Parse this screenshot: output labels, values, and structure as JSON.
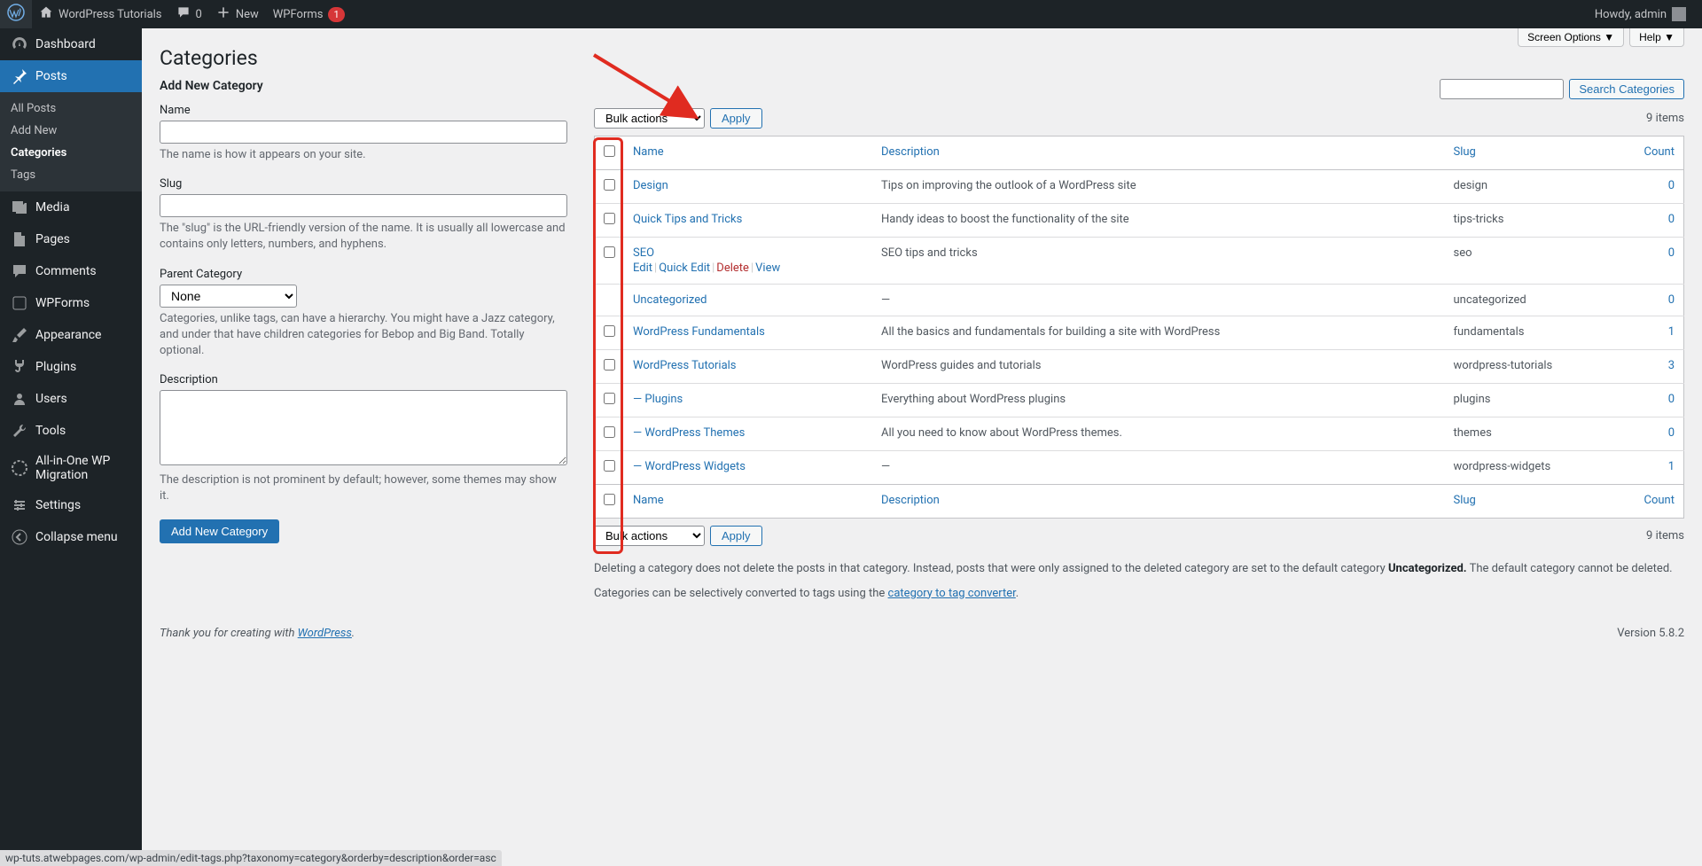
{
  "adminbar": {
    "site_name": "WordPress Tutorials",
    "comments": "0",
    "new": "New",
    "wpforms": "WPForms",
    "wpforms_badge": "1",
    "howdy": "Howdy, admin"
  },
  "sidebar": {
    "dashboard": "Dashboard",
    "posts": "Posts",
    "posts_sub": {
      "all": "All Posts",
      "add": "Add New",
      "categories": "Categories",
      "tags": "Tags"
    },
    "media": "Media",
    "pages": "Pages",
    "comments": "Comments",
    "wpforms": "WPForms",
    "appearance": "Appearance",
    "plugins": "Plugins",
    "users": "Users",
    "tools": "Tools",
    "aiowp": "All-in-One WP Migration",
    "settings": "Settings",
    "collapse": "Collapse menu"
  },
  "topright": {
    "screen_options": "Screen Options",
    "help": "Help"
  },
  "page_title": "Categories",
  "form": {
    "heading": "Add New Category",
    "name_label": "Name",
    "name_desc": "The name is how it appears on your site.",
    "slug_label": "Slug",
    "slug_desc": "The \"slug\" is the URL-friendly version of the name. It is usually all lowercase and contains only letters, numbers, and hyphens.",
    "parent_label": "Parent Category",
    "parent_selected": "None",
    "parent_desc": "Categories, unlike tags, can have a hierarchy. You might have a Jazz category, and under that have children categories for Bebop and Big Band. Totally optional.",
    "desc_label": "Description",
    "desc_desc": "The description is not prominent by default; however, some themes may show it.",
    "submit": "Add New Category"
  },
  "search": {
    "button": "Search Categories"
  },
  "bulk": {
    "label": "Bulk actions",
    "apply": "Apply",
    "items": "9 items"
  },
  "columns": {
    "name": "Name",
    "description": "Description",
    "slug": "Slug",
    "count": "Count"
  },
  "row_actions": {
    "edit": "Edit",
    "quick_edit": "Quick Edit",
    "delete": "Delete",
    "view": "View"
  },
  "rows": [
    {
      "name": "Design",
      "desc": "Tips on improving the outlook of a WordPress site",
      "slug": "design",
      "count": "0",
      "cb": true
    },
    {
      "name": "Quick Tips and Tricks",
      "desc": "Handy ideas to boost the functionality of the site",
      "slug": "tips-tricks",
      "count": "0",
      "cb": true
    },
    {
      "name": "SEO",
      "desc": "SEO tips and tricks",
      "slug": "seo",
      "count": "0",
      "cb": true,
      "actions": true
    },
    {
      "name": "Uncategorized",
      "desc": "—",
      "slug": "uncategorized",
      "count": "0",
      "cb": false
    },
    {
      "name": "WordPress Fundamentals",
      "desc": "All the basics and fundamentals for building a site with WordPress",
      "slug": "fundamentals",
      "count": "1",
      "cb": true
    },
    {
      "name": "WordPress Tutorials",
      "desc": "WordPress guides and tutorials",
      "slug": "wordpress-tutorials",
      "count": "3",
      "cb": true
    },
    {
      "name": "— Plugins",
      "desc": "Everything about WordPress plugins",
      "slug": "plugins",
      "count": "0",
      "cb": true
    },
    {
      "name": "— WordPress Themes",
      "desc": "All you need to know about WordPress themes.",
      "slug": "themes",
      "count": "0",
      "cb": true
    },
    {
      "name": "— WordPress Widgets",
      "desc": "—",
      "slug": "wordpress-widgets",
      "count": "1",
      "cb": true
    }
  ],
  "notes": {
    "p1a": "Deleting a category does not delete the posts in that category. Instead, posts that were only assigned to the deleted category are set to the default category ",
    "p1b": "Uncategorized.",
    "p1c": " The default category cannot be deleted.",
    "p2a": "Categories can be selectively converted to tags using the ",
    "p2b": "category to tag converter",
    "p2c": "."
  },
  "thank": {
    "text": "Thank you for creating with ",
    "link": "WordPress",
    "version": "Version 5.8.2"
  },
  "status_url": "wp-tuts.atwebpages.com/wp-admin/edit-tags.php?taxonomy=category&orderby=description&order=asc"
}
